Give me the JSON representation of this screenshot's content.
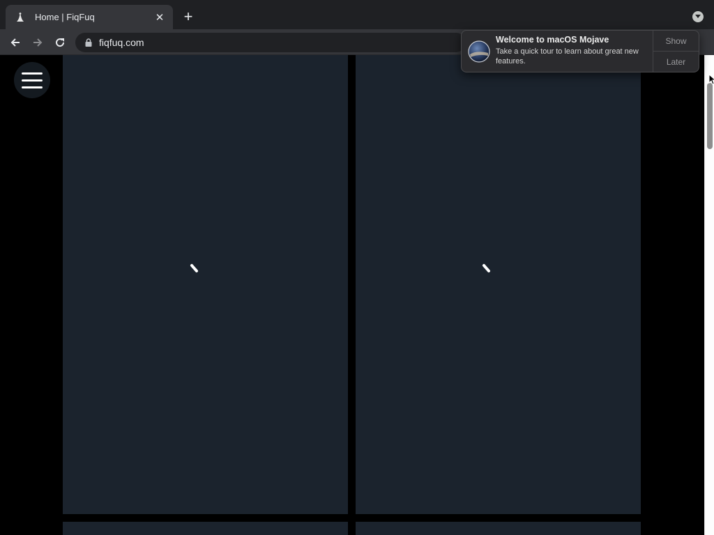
{
  "browser": {
    "tab": {
      "title": "Home | FiqFuq",
      "close_glyph": "✕"
    },
    "new_tab_glyph": "+",
    "address": {
      "url": "fiqfuq.com"
    }
  },
  "page": {
    "cards": [
      {
        "state": "loading"
      },
      {
        "state": "loading"
      },
      {
        "state": "partial"
      },
      {
        "state": "partial"
      }
    ]
  },
  "notification": {
    "title": "Welcome to macOS Mojave",
    "text": "Take a quick tour to learn about great new features.",
    "show_label": "Show",
    "later_label": "Later"
  },
  "colors": {
    "card_bg": "#1b232d",
    "page_bg": "#000000",
    "chrome_bg": "#35363a"
  }
}
